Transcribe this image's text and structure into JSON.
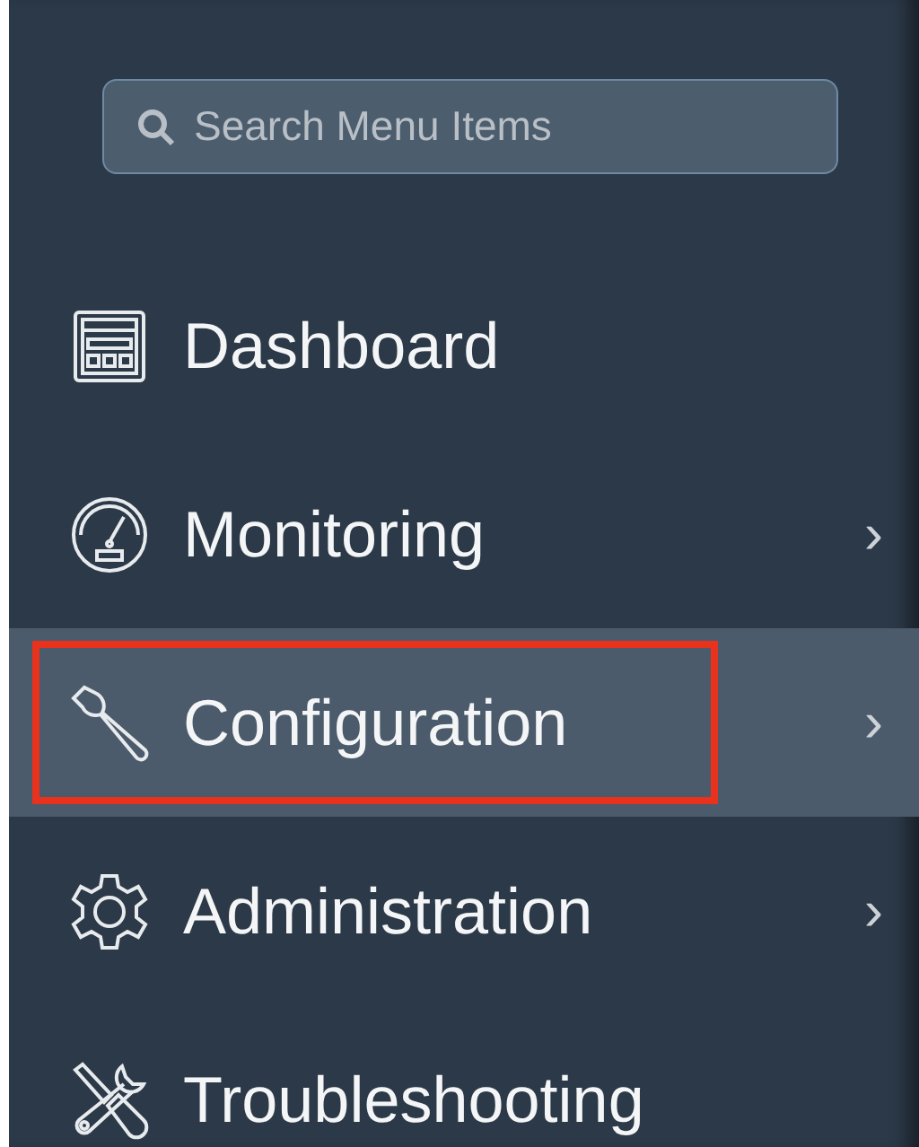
{
  "search": {
    "placeholder": "Search Menu Items"
  },
  "menu": [
    {
      "label": "Dashboard",
      "selected": false,
      "highlighted": false
    },
    {
      "label": "Monitoring",
      "selected": false,
      "highlighted": false,
      "chevron": "›"
    },
    {
      "label": "Configuration",
      "selected": true,
      "highlighted": true,
      "chevron": "›"
    },
    {
      "label": "Administration",
      "selected": false,
      "highlighted": false,
      "chevron": "›"
    },
    {
      "label": "Troubleshooting",
      "selected": false,
      "highlighted": false
    }
  ]
}
